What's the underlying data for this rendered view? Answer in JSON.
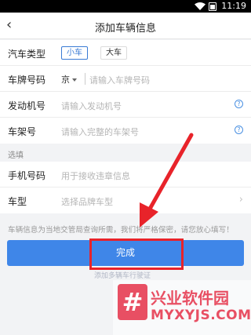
{
  "status_bar": {
    "time": "11:19"
  },
  "header": {
    "back_icon": "‹",
    "title": "添加车辆信息"
  },
  "required": {
    "vehicle_type": {
      "label": "汽车类型",
      "options": [
        "小车",
        "大车"
      ],
      "selected": "小车"
    },
    "plate": {
      "label": "车牌号码",
      "province": "京",
      "placeholder": "请输入车牌号码"
    },
    "engine": {
      "label": "发动机号",
      "placeholder": "请输入发动机号",
      "help": "?"
    },
    "frame": {
      "label": "车架号",
      "placeholder": "请输入完整的车架号",
      "help": "?"
    }
  },
  "optional": {
    "section_label": "选填",
    "phone": {
      "label": "手机号码",
      "placeholder": "用于接收违章信息"
    },
    "model": {
      "label": "车型",
      "placeholder": "选择品牌车型"
    }
  },
  "notice": "车辆信息为当地交管局查询所需，我们将严格保密，请您放心填写！",
  "submit": {
    "label": "完成"
  },
  "sub_link": "添加多辆车行驶证",
  "annotation": {
    "color": "#e8232a"
  },
  "watermark": {
    "logo_char": "#",
    "title": "兴业软件园",
    "url": "MYXYJS.COM",
    "color": "#e84f63"
  }
}
